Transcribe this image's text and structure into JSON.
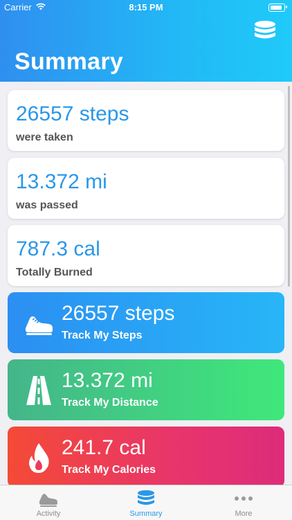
{
  "status_bar": {
    "carrier": "Carrier",
    "time": "8:15 PM"
  },
  "header": {
    "title": "Summary",
    "action_icon": "database-icon"
  },
  "summary_cards": [
    {
      "value": "26557 steps",
      "label": "were taken"
    },
    {
      "value": "13.372 mi",
      "label": "was passed"
    },
    {
      "value": "787.3 cal",
      "label": "Totally Burned"
    }
  ],
  "track_cards": [
    {
      "value": "26557 steps",
      "label": "Track My Steps",
      "icon": "shoe-icon"
    },
    {
      "value": "13.372 mi",
      "label": "Track My Distance",
      "icon": "road-icon"
    },
    {
      "value": "241.7 cal",
      "label": "Track My Calories",
      "icon": "flame-icon"
    }
  ],
  "tabs": [
    {
      "label": "Activity",
      "icon": "shoe-icon",
      "active": false
    },
    {
      "label": "Summary",
      "icon": "database-icon",
      "active": true
    },
    {
      "label": "More",
      "icon": "more-dots-icon",
      "active": false
    }
  ],
  "colors": {
    "accent": "#2a97e8",
    "steps": "#2b8ff2",
    "distance": "#3fe87a",
    "calories": "#e8356b"
  }
}
